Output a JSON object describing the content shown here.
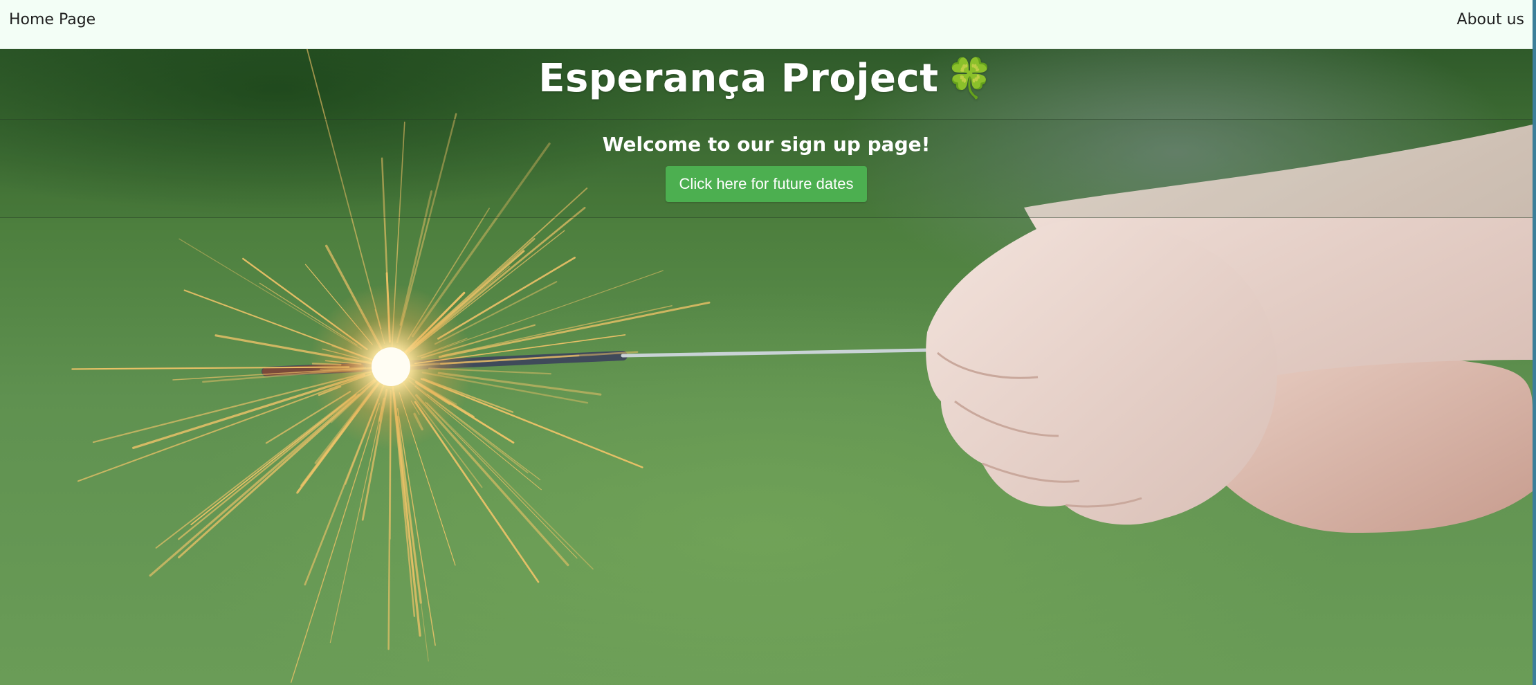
{
  "nav": {
    "home_label": "Home Page",
    "about_label": "About us"
  },
  "hero": {
    "title": "Esperança Project",
    "title_icon": "🍀",
    "subtitle": "Welcome to our sign up page!",
    "cta_label": "Click here for future dates",
    "background_image": "sparkler-held-by-child-hand-icon"
  },
  "colors": {
    "navbar_bg": "#f3fef6",
    "cta_bg": "#4caf50",
    "text_on_hero": "#ffffff"
  }
}
